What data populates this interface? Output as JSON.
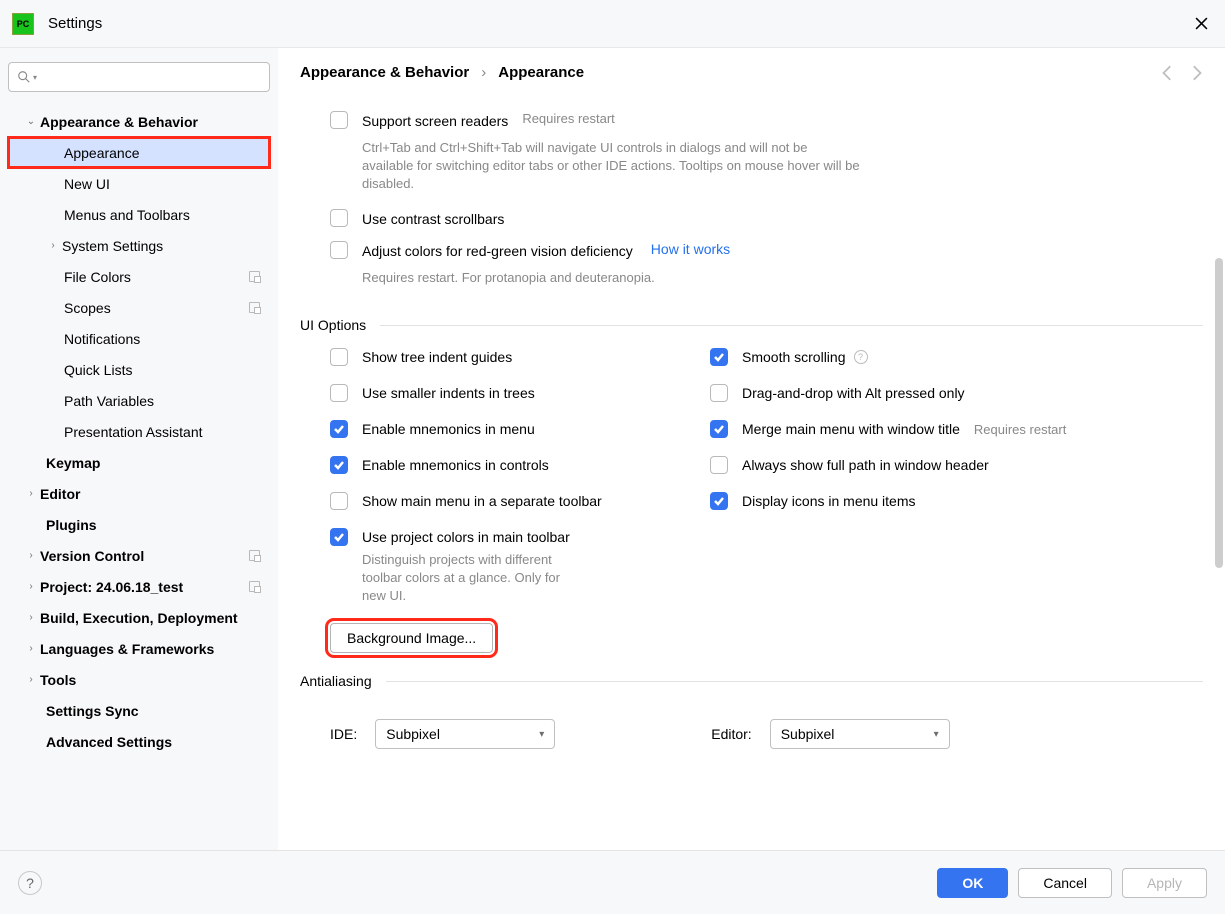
{
  "window": {
    "title": "Settings",
    "app_badge": "PC"
  },
  "breadcrumb": {
    "group": "Appearance & Behavior",
    "page": "Appearance"
  },
  "sidebar": {
    "items": [
      {
        "label": "Appearance & Behavior",
        "bold": true,
        "chev": "down",
        "ind": 0
      },
      {
        "label": "Appearance",
        "ind": 2,
        "selected": true,
        "highlighted": true
      },
      {
        "label": "New UI",
        "ind": 2
      },
      {
        "label": "Menus and Toolbars",
        "ind": 2
      },
      {
        "label": "System Settings",
        "ind": 2,
        "chev": "right",
        "chev_ind": true
      },
      {
        "label": "File Colors",
        "ind": 2,
        "badge": true
      },
      {
        "label": "Scopes",
        "ind": 2,
        "badge": true
      },
      {
        "label": "Notifications",
        "ind": 2
      },
      {
        "label": "Quick Lists",
        "ind": 2
      },
      {
        "label": "Path Variables",
        "ind": 2
      },
      {
        "label": "Presentation Assistant",
        "ind": 2
      },
      {
        "label": "Keymap",
        "bold": true,
        "ind": 1
      },
      {
        "label": "Editor",
        "bold": true,
        "chev": "right",
        "ind": 0
      },
      {
        "label": "Plugins",
        "bold": true,
        "ind": 1
      },
      {
        "label": "Version Control",
        "bold": true,
        "chev": "right",
        "ind": 0,
        "badge": true
      },
      {
        "label": "Project: 24.06.18_test",
        "bold": true,
        "chev": "right",
        "ind": 0,
        "badge": true
      },
      {
        "label": "Build, Execution, Deployment",
        "bold": true,
        "chev": "right",
        "ind": 0
      },
      {
        "label": "Languages & Frameworks",
        "bold": true,
        "chev": "right",
        "ind": 0
      },
      {
        "label": "Tools",
        "bold": true,
        "chev": "right",
        "ind": 0
      },
      {
        "label": "Settings Sync",
        "bold": true,
        "ind": 1
      },
      {
        "label": "Advanced Settings",
        "bold": true,
        "ind": 1
      }
    ]
  },
  "options": {
    "support_readers": {
      "label": "Support screen readers",
      "hint": "Requires restart",
      "desc": "Ctrl+Tab and Ctrl+Shift+Tab will navigate UI controls in dialogs and will not be available for switching editor tabs or other IDE actions. Tooltips on mouse hover will be disabled."
    },
    "contrast": {
      "label": "Use contrast scrollbars"
    },
    "color_def": {
      "label": "Adjust colors for red-green vision deficiency",
      "link": "How it works",
      "desc": "Requires restart. For protanopia and deuteranopia."
    }
  },
  "ui_section": {
    "title": "UI Options",
    "tree_guides": "Show tree indent guides",
    "smooth": "Smooth scrolling",
    "smaller_indents": "Use smaller indents in trees",
    "dnd_alt": "Drag-and-drop with Alt pressed only",
    "mnemonics_menu": "Enable mnemonics in menu",
    "merge_menu": "Merge main menu with window title",
    "merge_hint": "Requires restart",
    "mnemonics_ctrl": "Enable mnemonics in controls",
    "full_path": "Always show full path in window header",
    "main_menu_toolbar": "Show main menu in a separate toolbar",
    "icons_menu": "Display icons in menu items",
    "proj_colors": "Use project colors in main toolbar",
    "proj_colors_desc": "Distinguish projects with different toolbar colors at a glance. Only for new UI.",
    "bg_image": "Background Image..."
  },
  "aa_section": {
    "title": "Antialiasing",
    "ide_label": "IDE:",
    "ide_value": "Subpixel",
    "editor_label": "Editor:",
    "editor_value": "Subpixel"
  },
  "footer": {
    "ok": "OK",
    "cancel": "Cancel",
    "apply": "Apply"
  }
}
